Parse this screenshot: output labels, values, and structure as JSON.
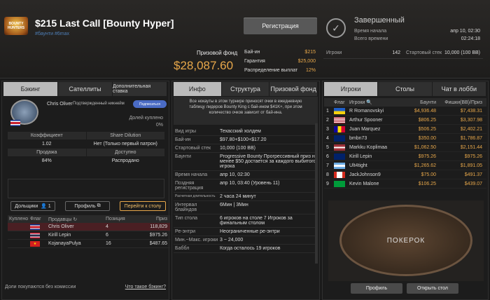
{
  "header": {
    "logo_text": "BOUNTY HUNTERS",
    "title": "$215 Last Call [Bounty Hyper]",
    "tags": "#баунти #6max",
    "register": "Регистрация",
    "prize_label": "Призовой фонд",
    "prize_value": "$28,087.60",
    "fees": [
      {
        "k": "Бай-ин",
        "v": "$215"
      },
      {
        "k": "Гарантия",
        "v": "$25,000"
      },
      {
        "k": "Распределение выплат",
        "v": "12%"
      }
    ],
    "status": "Завершенный",
    "meta": [
      {
        "k": "Время начала",
        "v": "апр 10, 02:30"
      },
      {
        "k": "Всего времени",
        "v": "02:24:18"
      }
    ],
    "players_label": "Игроки",
    "players_val": "142",
    "stack_label": "Стартовый стек",
    "stack_val": "10,000 (100 BB)"
  },
  "left": {
    "tabs": [
      "Бэкинг",
      "Сателлиты",
      "Дополнительная ставка"
    ],
    "player": "Chris Oliver",
    "verified": "Подтвержденный никнейм",
    "subscribe": "Подписаться",
    "sold_label": "Долей куплено",
    "sold_val": "0%",
    "grid": [
      {
        "h": "Коэффициент",
        "v": "1.02"
      },
      {
        "h": "Share Dilution",
        "v": "Нет (Только первый патрон)"
      },
      {
        "h": "Продажа",
        "v": "84%"
      },
      {
        "h": "Доступно",
        "v": "Распродано"
      }
    ],
    "shares_btn": "Дольщики",
    "shares_count": "1",
    "profile_btn": "Профиль",
    "goto_btn": "Перейти к столу",
    "cols": [
      "Куплено",
      "Флаг",
      "Продавцы",
      "Позиция",
      "Приз"
    ],
    "rows": [
      {
        "name": "Chris Oliver",
        "pos": "4",
        "prize": "118,829"
      },
      {
        "name": "Kirill Lepin",
        "pos": "6",
        "prize": "$975.26"
      },
      {
        "name": "KojanayaPulya",
        "pos": "16",
        "prize": "$487.65"
      }
    ],
    "foot": "Доли покупаются без комиссии",
    "foot_link": "Что такое бэкинг?"
  },
  "mid": {
    "tabs": [
      "Инфо",
      "Структура",
      "Призовой фонд"
    ],
    "notice": "Все нокауты в этом турнире приносят очки в ежедневную таблицу лидеров Bounty King с бай-ином $41K+, при этом количество очков зависит от бай-ина.",
    "rows": [
      {
        "k": "Вид игры",
        "v": "Техасский холдем"
      },
      {
        "k": "Бай-ин",
        "v": "$97.80+$100+$17.20"
      },
      {
        "k": "Стартовый стек",
        "v": "10,000 (100 BB)"
      },
      {
        "k": "Баунти",
        "v": "Progressive Bounty Прогрессивный приз не менее $50 достается за каждого выбитого игрока"
      },
      {
        "k": "Время начала",
        "v": "апр 10, 02:30"
      },
      {
        "k": "Поздняя регистрация",
        "v": "апр 10, 03:40 (Уровень 11)"
      },
      {
        "k": "Расчетная длительность",
        "v": "2 часа 24 минут"
      },
      {
        "k": "Интервал блайндов",
        "v": "6Мин | 3Мин"
      },
      {
        "k": "Тип стола",
        "v": "6 игроков на столе 7 Игроков за финальным столом"
      },
      {
        "k": "Ре-энтри",
        "v": "Неограниченные ре-энтри"
      },
      {
        "k": "Мин.~Макс. игроки",
        "v": "3 ~ 24,000"
      },
      {
        "k": "Баббл",
        "v": "Когда осталось 19 игроков"
      }
    ]
  },
  "right": {
    "tabs": [
      "Игроки",
      "Столы",
      "Чат в лобби"
    ],
    "cols": [
      "Флаг",
      "Игроки",
      "Баунти",
      "Фишки(BB)/Приз"
    ],
    "players": [
      {
        "n": "1",
        "flag": "ua",
        "name": "R Romanovskyi",
        "bounty": "$4,936.48",
        "chips": "$7,438.31"
      },
      {
        "n": "2",
        "flag": "us",
        "name": "Arthur Spooner",
        "bounty": "$806.25",
        "chips": "$3,307.98"
      },
      {
        "n": "3",
        "flag": "ad",
        "name": "Juan Marquez",
        "bounty": "$506.25",
        "chips": "$2,402.21"
      },
      {
        "n": "4",
        "flag": "gb",
        "name": "bmbn73",
        "bounty": "$350.00",
        "chips": "$1,786.87"
      },
      {
        "n": "5",
        "flag": "lv",
        "name": "Markku Koplimaa",
        "bounty": "$1,062.50",
        "chips": "$2,151.44"
      },
      {
        "n": "6",
        "flag": "gb",
        "name": "Kirill Lepin",
        "bounty": "$975.26",
        "chips": "$975.26"
      },
      {
        "n": "7",
        "flag": "ar",
        "name": "Ult4tight",
        "bounty": "$1,265.62",
        "chips": "$1,891.05"
      },
      {
        "n": "8",
        "flag": "ca",
        "name": "JackJohnson9",
        "bounty": "$75.00",
        "chips": "$491.37"
      },
      {
        "n": "9",
        "flag": "br",
        "name": "Kevin Malone",
        "bounty": "$106.25",
        "chips": "$439.07"
      }
    ],
    "table_label": "ПОКЕРОК",
    "profile": "Профиль",
    "open": "Открыть стол"
  }
}
